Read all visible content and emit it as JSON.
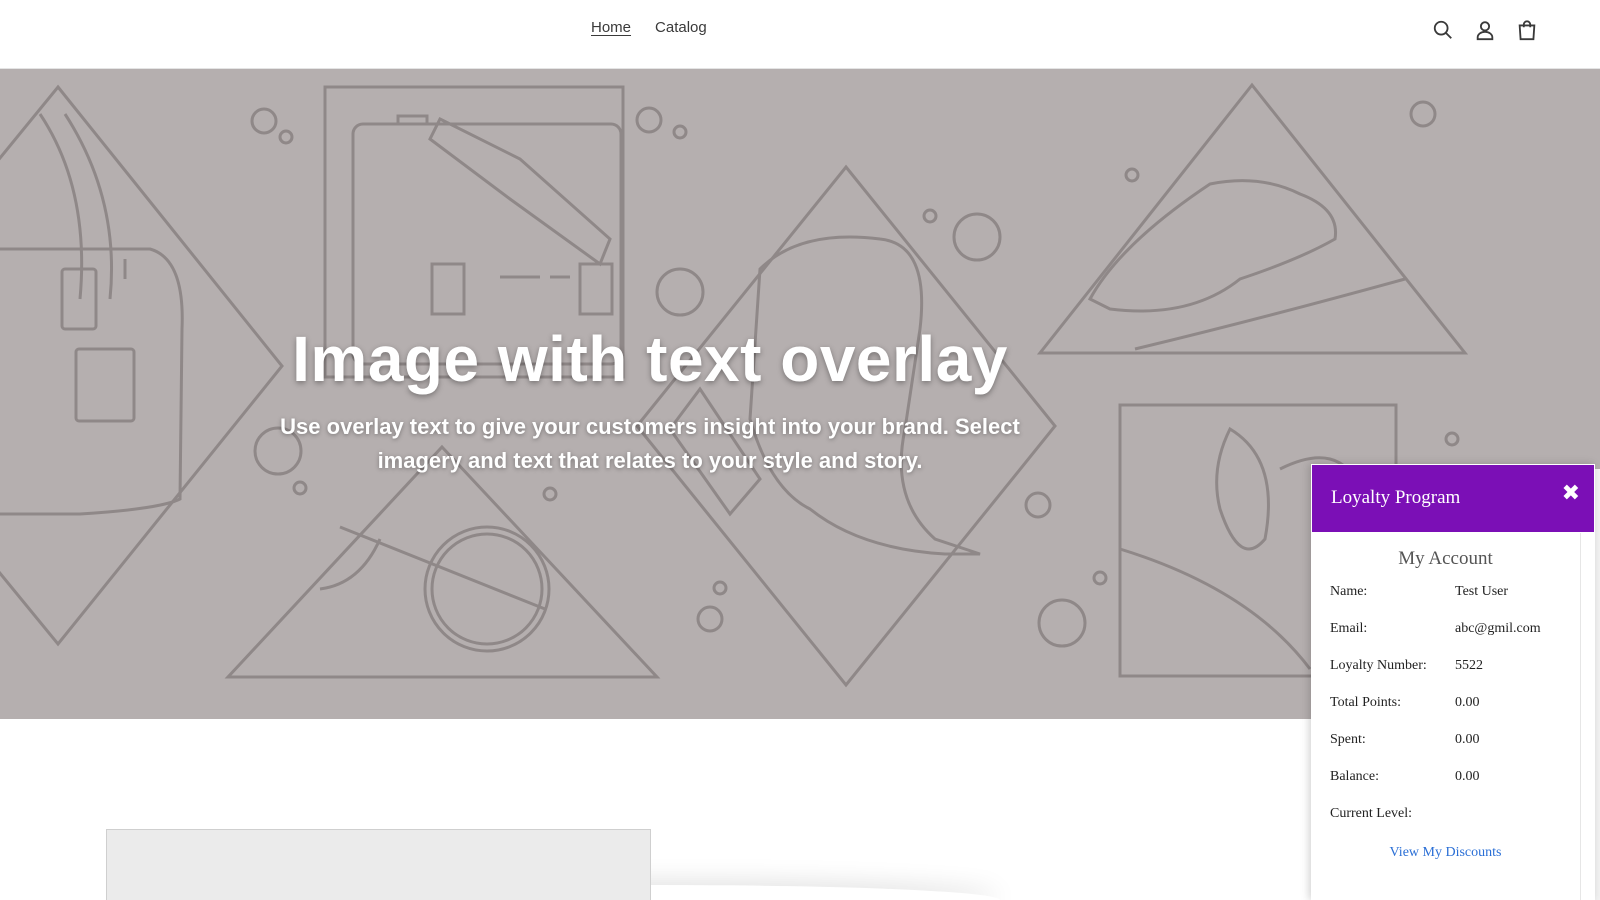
{
  "header": {
    "nav": [
      {
        "label": "Home",
        "active": true
      },
      {
        "label": "Catalog",
        "active": false
      }
    ],
    "icons": [
      "search-icon",
      "account-icon",
      "cart-icon"
    ]
  },
  "hero": {
    "title": "Image with text overlay",
    "subtitle": "Use overlay text to give your customers insight into your brand. Select imagery and text that relates to your style and story.",
    "background_color": "#b5afaf"
  },
  "loyalty": {
    "title": "Loyalty Program",
    "close_symbol": "✖",
    "header_color": "#7b0fb6",
    "account_title": "My Account",
    "fields": [
      {
        "label": "Name:",
        "value": "Test User"
      },
      {
        "label": "Email:",
        "value": "abc@gmil.com"
      },
      {
        "label": "Loyalty Number:",
        "value": "5522"
      },
      {
        "label": "Total Points:",
        "value": "0.00"
      },
      {
        "label": "Spent:",
        "value": "0.00"
      },
      {
        "label": "Balance:",
        "value": "0.00"
      },
      {
        "label": "Current Level:",
        "value": ""
      }
    ],
    "discounts_link": "View My Discounts",
    "link_color": "#2a6fd6"
  }
}
